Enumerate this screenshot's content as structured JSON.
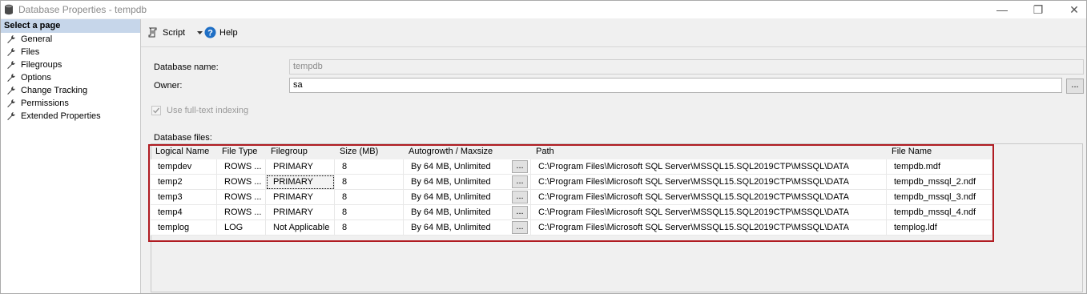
{
  "window": {
    "title": "Database Properties - tempdb",
    "minimize_glyph": "—",
    "restore_glyph": "❐",
    "close_glyph": "✕"
  },
  "sidebar": {
    "header": "Select a page",
    "items": [
      {
        "label": "General",
        "icon": "wrench-icon"
      },
      {
        "label": "Files",
        "icon": "wrench-icon"
      },
      {
        "label": "Filegroups",
        "icon": "wrench-icon"
      },
      {
        "label": "Options",
        "icon": "wrench-icon"
      },
      {
        "label": "Change Tracking",
        "icon": "wrench-icon"
      },
      {
        "label": "Permissions",
        "icon": "wrench-icon"
      },
      {
        "label": "Extended Properties",
        "icon": "wrench-icon"
      }
    ]
  },
  "toolbar": {
    "script_label": "Script",
    "help_label": "Help"
  },
  "form": {
    "database_name_label": "Database name:",
    "database_name_value": "tempdb",
    "owner_label": "Owner:",
    "owner_value": "sa",
    "owner_browse": "...",
    "fulltext_label": "Use full-text indexing",
    "fulltext_checked": true,
    "files_label": "Database files:"
  },
  "files_grid": {
    "columns": [
      "Logical Name",
      "File Type",
      "Filegroup",
      "Size (MB)",
      "Autogrowth / Maxsize",
      "Path",
      "File Name"
    ],
    "rows": [
      {
        "logical_name": "tempdev",
        "file_type": "ROWS ...",
        "filegroup": "PRIMARY",
        "size": "8",
        "autogrowth": "By 64 MB, Unlimited",
        "path": "C:\\Program Files\\Microsoft SQL Server\\MSSQL15.SQL2019CTP\\MSSQL\\DATA",
        "file_name": "tempdb.mdf"
      },
      {
        "logical_name": "temp2",
        "file_type": "ROWS ...",
        "filegroup": "PRIMARY",
        "size": "8",
        "autogrowth": "By 64 MB, Unlimited",
        "path": "C:\\Program Files\\Microsoft SQL Server\\MSSQL15.SQL2019CTP\\MSSQL\\DATA",
        "file_name": "tempdb_mssql_2.ndf"
      },
      {
        "logical_name": "temp3",
        "file_type": "ROWS ...",
        "filegroup": "PRIMARY",
        "size": "8",
        "autogrowth": "By 64 MB, Unlimited",
        "path": "C:\\Program Files\\Microsoft SQL Server\\MSSQL15.SQL2019CTP\\MSSQL\\DATA",
        "file_name": "tempdb_mssql_3.ndf"
      },
      {
        "logical_name": "temp4",
        "file_type": "ROWS ...",
        "filegroup": "PRIMARY",
        "size": "8",
        "autogrowth": "By 64 MB, Unlimited",
        "path": "C:\\Program Files\\Microsoft SQL Server\\MSSQL15.SQL2019CTP\\MSSQL\\DATA",
        "file_name": "tempdb_mssql_4.ndf"
      },
      {
        "logical_name": "templog",
        "file_type": "LOG",
        "filegroup": "Not Applicable",
        "size": "8",
        "autogrowth": "By 64 MB, Unlimited",
        "path": "C:\\Program Files\\Microsoft SQL Server\\MSSQL15.SQL2019CTP\\MSSQL\\DATA",
        "file_name": "templog.ldf"
      }
    ],
    "selected_row": 1,
    "selected_column": "filegroup",
    "row_button": "...",
    "highlight_color": "#b01c22"
  }
}
